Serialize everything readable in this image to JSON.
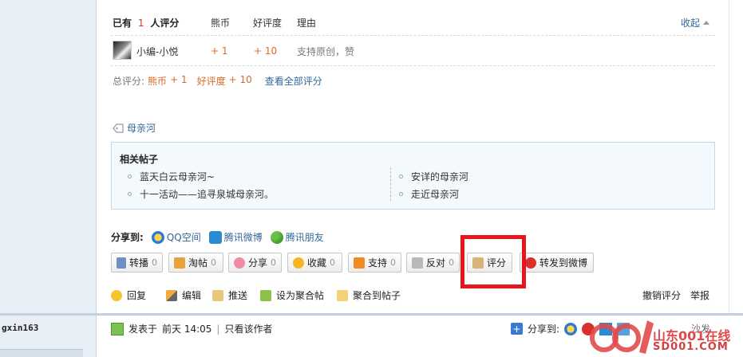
{
  "rating": {
    "header_prefix": "已有",
    "count": "1",
    "header_suffix": "人评分",
    "col_coin": "熊币",
    "col_praise": "好评度",
    "col_reason": "理由",
    "collapse_label": "收起",
    "entries": [
      {
        "user": "小编-小悦",
        "coin": "+ 1",
        "praise": "+ 10",
        "reason": "支持原创，赞"
      }
    ],
    "total_label": "总评分:",
    "total_coin_label": "熊币",
    "total_coin_value": "+ 1",
    "total_praise_label": "好评度",
    "total_praise_value": "+ 10",
    "view_all_label": "查看全部评分"
  },
  "tag": {
    "label": "母亲河"
  },
  "related": {
    "title": "相关帖子",
    "left": [
      "蓝天白云母亲河~",
      "十一活动——追寻泉城母亲河。"
    ],
    "right": [
      "安详的母亲河",
      "走近母亲河"
    ]
  },
  "share": {
    "label": "分享到:",
    "items": [
      "QQ空间",
      "腾讯微博",
      "腾讯朋友"
    ]
  },
  "buttons": [
    {
      "label": "转播",
      "count": "0"
    },
    {
      "label": "淘帖",
      "count": "0"
    },
    {
      "label": "分享",
      "count": "0"
    },
    {
      "label": "收藏",
      "count": "0"
    },
    {
      "label": "支持",
      "count": "0"
    },
    {
      "label": "反对",
      "count": "0"
    },
    {
      "label": "评分"
    },
    {
      "label": "转发到微博"
    }
  ],
  "actions": [
    "回复",
    "编辑",
    "推送",
    "设为聚合帖",
    "聚合到帖子"
  ],
  "right_actions": {
    "undo_rate": "撤销评分",
    "report": "举报"
  },
  "next_post": {
    "username": "gxin163",
    "posted_prefix": "发表于",
    "time": "前天 14:05",
    "only_author": "只看该作者",
    "share_label": "分享到:",
    "floor": "沙发"
  },
  "watermark": {
    "line1": "山东001在线",
    "line2": "SD001.COM"
  },
  "colors": {
    "highlight": "#e5161c",
    "link": "#336699",
    "accent_orange": "#d76b2a"
  }
}
